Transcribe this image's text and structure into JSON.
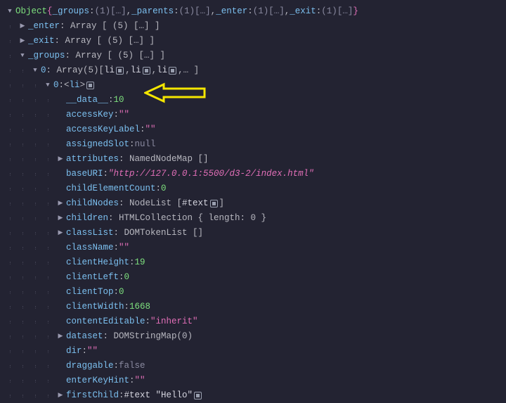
{
  "header": {
    "prefix": "Object ",
    "groupsKey": "_groups",
    "parentsKey": "_parents",
    "enterKey": "_enter",
    "exitKey": "_exit",
    "count": "(1)",
    "ellipsis": "[…]"
  },
  "lines": [
    {
      "ind": 1,
      "twist": "right",
      "key": "_enter",
      "aft": ": Array [ (5) […] ]"
    },
    {
      "ind": 1,
      "twist": "right",
      "key": "_exit",
      "aft": ": Array [ (5) […] ]"
    },
    {
      "ind": 1,
      "twist": "down",
      "key": "_groups",
      "aft": ": Array [ (5) […] ]"
    },
    {
      "ind": 2,
      "twist": "down",
      "key": "0",
      "aftPre": ": Array(5) ",
      "li": true
    },
    {
      "ind": 3,
      "twist": "down",
      "key": "0",
      "aftPre": ": ",
      "liTag": true
    },
    {
      "ind": 4,
      "twist": "none",
      "key": "__data__",
      "valNum": "10"
    },
    {
      "ind": 4,
      "twist": "none",
      "key": "accessKey",
      "valStr": "\"\""
    },
    {
      "ind": 4,
      "twist": "none",
      "key": "accessKeyLabel",
      "valStr": "\"\""
    },
    {
      "ind": 4,
      "twist": "none",
      "key": "assignedSlot",
      "valMuted": "null"
    },
    {
      "ind": 4,
      "twist": "right",
      "key": "attributes",
      "aft": ": NamedNodeMap []"
    },
    {
      "ind": 4,
      "twist": "none",
      "key": "baseURI",
      "valEmStr": "\"http://127.0.0.1:5500/d3-2/index.html\""
    },
    {
      "ind": 4,
      "twist": "none",
      "key": "childElementCount",
      "valNum": "0"
    },
    {
      "ind": 4,
      "twist": "right",
      "key": "childNodes",
      "aftNodeList": true
    },
    {
      "ind": 4,
      "twist": "right",
      "key": "children",
      "aft": ": HTMLCollection { length: 0 }"
    },
    {
      "ind": 4,
      "twist": "right",
      "key": "classList",
      "aft": ": DOMTokenList []"
    },
    {
      "ind": 4,
      "twist": "none",
      "key": "className",
      "valStr": "\"\""
    },
    {
      "ind": 4,
      "twist": "none",
      "key": "clientHeight",
      "valNum": "19"
    },
    {
      "ind": 4,
      "twist": "none",
      "key": "clientLeft",
      "valNum": "0"
    },
    {
      "ind": 4,
      "twist": "none",
      "key": "clientTop",
      "valNum": "0"
    },
    {
      "ind": 4,
      "twist": "none",
      "key": "clientWidth",
      "valNum": "1668"
    },
    {
      "ind": 4,
      "twist": "none",
      "key": "contentEditable",
      "valStr": "\"inherit\""
    },
    {
      "ind": 4,
      "twist": "right",
      "key": "dataset",
      "aft": ": DOMStringMap(0)"
    },
    {
      "ind": 4,
      "twist": "none",
      "key": "dir",
      "valStr": "\"\""
    },
    {
      "ind": 4,
      "twist": "none",
      "key": "draggable",
      "valMuted": "false"
    },
    {
      "ind": 4,
      "twist": "none",
      "key": "enterKeyHint",
      "valStr": "\"\""
    },
    {
      "ind": 4,
      "twist": "right",
      "key": "firstChild",
      "aftFirstChild": true
    }
  ],
  "arrayHeader": {
    "liLabel": "li",
    "comma": " , ",
    "tail": " , … ]"
  },
  "liTagOpen": "<",
  "liTagName": "li",
  "liTagClose": ">",
  "nodeListLabel": ": NodeList [ ",
  "textNodeLabel": "#text",
  "nodeListTail": " ]",
  "firstChildLabel": ": ",
  "firstChildText": "#text \"Hello\""
}
